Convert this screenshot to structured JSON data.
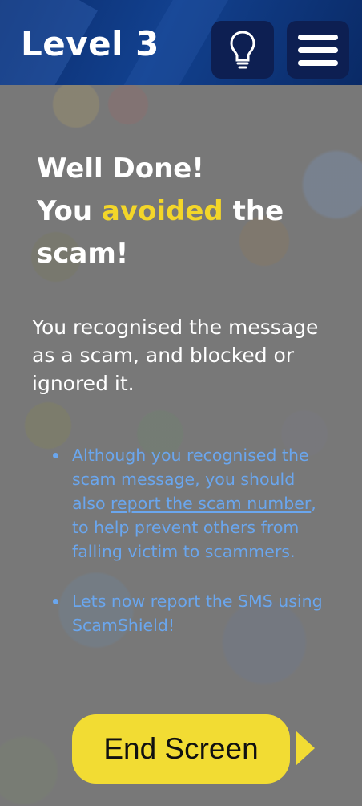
{
  "header": {
    "title": "Level 3",
    "hint_icon": "lightbulb-icon",
    "menu_icon": "hamburger-menu-icon"
  },
  "result": {
    "headline_line1": "Well Done!",
    "headline_you": "You",
    "headline_accent": "avoided",
    "headline_the": "the",
    "headline_line3": "scam!",
    "summary": "You recognised the message as a scam, and blocked or ignored it."
  },
  "tips": [
    {
      "before": "Although you recognised the scam message, you should also ",
      "link": "report the scam number",
      "after": ", to help prevent others from falling victim to scammers."
    },
    {
      "before": "Lets now report the SMS using ScamShield!",
      "link": "",
      "after": ""
    }
  ],
  "actions": {
    "end_label": "End Screen",
    "next_icon": "play-arrow-icon"
  },
  "colors": {
    "header_bg": "#0b2d6e",
    "accent_yellow": "#f3d629",
    "tip_blue": "#6aa6ee",
    "button_yellow": "#f2dc33",
    "overlay_gray": "#787878"
  }
}
